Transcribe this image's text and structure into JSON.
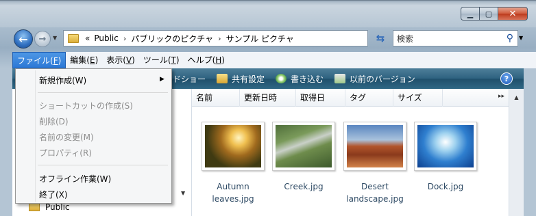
{
  "address": {
    "overflow": "«",
    "crumbs": [
      "Public",
      "パブリックのピクチャ",
      "サンプル ピクチャ"
    ]
  },
  "search": {
    "placeholder": "検索"
  },
  "menubar": {
    "items": [
      {
        "label": "ファイル(",
        "key": "F",
        "tail": ")"
      },
      {
        "label": "編集(",
        "key": "E",
        "tail": ")"
      },
      {
        "label": "表示(",
        "key": "V",
        "tail": ")"
      },
      {
        "label": "ツール(",
        "key": "T",
        "tail": ")"
      },
      {
        "label": "ヘルプ(",
        "key": "H",
        "tail": ")"
      }
    ]
  },
  "toolbar": {
    "slideshow": "ドショー",
    "share": "共有設定",
    "burn": "書き込む",
    "previous_versions": "以前のバージョン",
    "help": "?"
  },
  "columns": [
    "名前",
    "更新日時",
    "取得日",
    "タグ",
    "サイズ"
  ],
  "nav_pane": {
    "public": "Public"
  },
  "files": [
    {
      "line1": "Autumn",
      "line2": "leaves.jpg"
    },
    {
      "line1": "Creek.jpg",
      "line2": ""
    },
    {
      "line1": "Desert",
      "line2": "landscape.jpg"
    },
    {
      "line1": "Dock.jpg",
      "line2": ""
    }
  ],
  "file_menu": {
    "new": "新規作成(W)",
    "create_shortcut": "ショートカットの作成(S)",
    "delete": "削除(D)",
    "rename": "名前の変更(M)",
    "properties": "プロパティ(R)",
    "work_offline": "オフライン作業(W)",
    "exit": "終了(X)"
  }
}
